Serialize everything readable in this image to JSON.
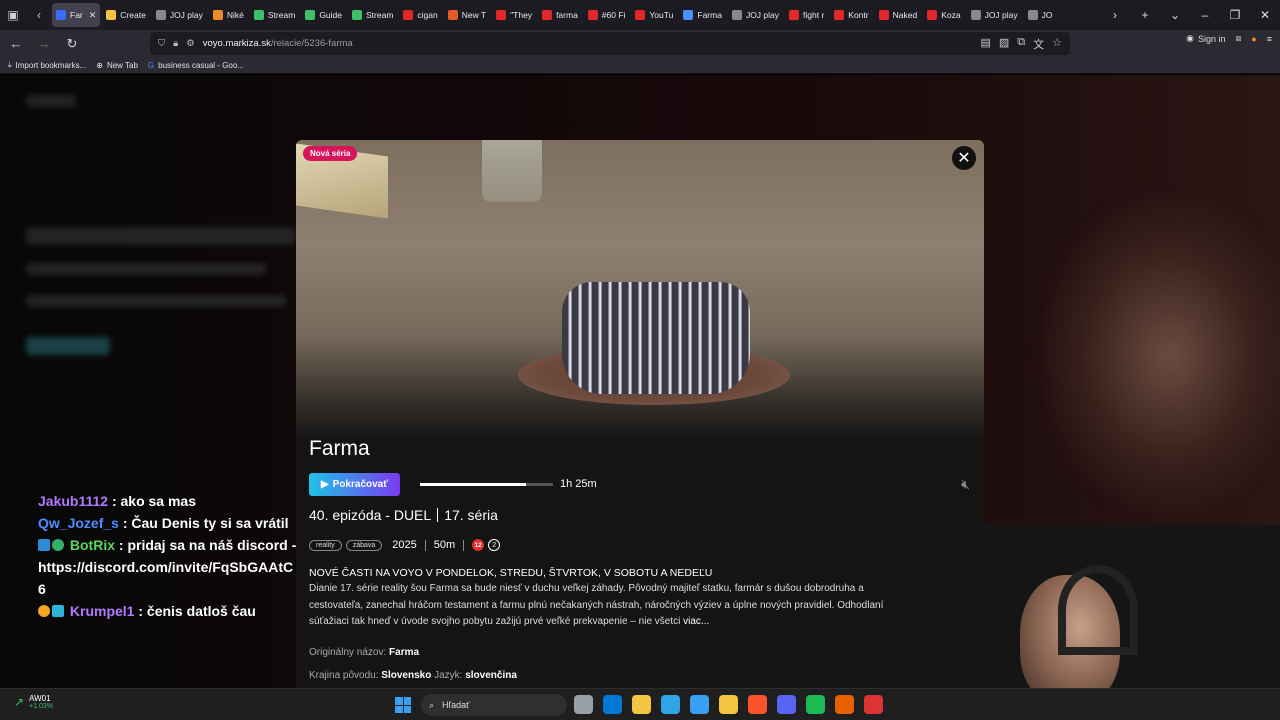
{
  "browser": {
    "tabs": [
      {
        "label": "Far",
        "color": "#3b6cff",
        "active": true
      },
      {
        "label": "Create",
        "color": "#f4c542"
      },
      {
        "label": "JOJ play",
        "color": "#888888"
      },
      {
        "label": "Niké",
        "color": "#f08a24"
      },
      {
        "label": "Stream",
        "color": "#3cc06a"
      },
      {
        "label": "Guide",
        "color": "#3cc06a"
      },
      {
        "label": "Stream",
        "color": "#3cc06a"
      },
      {
        "label": "cigan",
        "color": "#e3282c"
      },
      {
        "label": "New T",
        "color": "#e55b2b"
      },
      {
        "label": "\"They",
        "color": "#e3282c"
      },
      {
        "label": "farma",
        "color": "#e3282c"
      },
      {
        "label": "#60 Fi",
        "color": "#e3282c"
      },
      {
        "label": "YouTu",
        "color": "#e3282c"
      },
      {
        "label": "Farma",
        "color": "#4c8dff"
      },
      {
        "label": "JOJ play",
        "color": "#888888"
      },
      {
        "label": "fight r",
        "color": "#e3282c"
      },
      {
        "label": "Kontr",
        "color": "#e3282c"
      },
      {
        "label": "Naked",
        "color": "#e3282c"
      },
      {
        "label": "Koza",
        "color": "#e3282c"
      },
      {
        "label": "JOJ play",
        "color": "#888888"
      },
      {
        "label": "JO",
        "color": "#888888"
      }
    ],
    "url_domain": "voyo.markiza.sk",
    "url_path": "/relacie/5236-farma",
    "sign_in": "Sign in",
    "bookmarks": [
      "Import bookmarks...",
      "New Tab",
      "business casual - Goo..."
    ]
  },
  "chat": [
    {
      "user": "Jakub1112",
      "msg": ": ako sa mas"
    },
    {
      "user": "Qw_Jozef_s",
      "msg": ": Čau Denis ty si sa vrátil"
    },
    {
      "user": "BotRix",
      "msg": ": pridaj sa na náš discord - https://discord.com/invite/FqSbGAAtC6"
    },
    {
      "user": "Krumpel1",
      "msg": ": čenis datloš čau"
    }
  ],
  "modal": {
    "badge": "Nová séria",
    "title": "Farma",
    "play_label": "Pokračovať",
    "progress": 0.8,
    "duration": "1h 25m",
    "episode": "40. epizóda - DUEL",
    "season": "17. séria",
    "tags": [
      "reality",
      "zábava"
    ],
    "year": "2025",
    "length": "50m",
    "age_rating": "12",
    "age_rating_2": "2",
    "headline": "NOVÉ ČASTI NA VOYO V PONDELOK, STREDU, ŠTVRTOK, V SOBOTU A NEDEĽU",
    "description": "Dianie 17. série reality šou Farma sa bude niesť v duchu veľkej záhady. Pôvodný majiteľ statku, farmár s dušou dobrodruha a cestovateľa, zanechal hráčom testament a farmu plnú nečakaných nástrah, náročných výziev a úplne nových pravidiel. Odhodlaní súťažiaci tak hneď v úvode svojho pobytu zažijú prvé veľké prekvapenie – nie všetci",
    "more": "viac...",
    "original_title_label": "Originálny názov:",
    "original_title": "Farma",
    "country_label": "Krajina pôvodu:",
    "country": "Slovensko",
    "language_label": "Jazyk:",
    "language": "slovenčina"
  },
  "taskbar": {
    "stock_name": "AW01",
    "stock_change": "+1.03%",
    "search_placeholder": "Hľadať",
    "apps": [
      "#9aa0a8",
      "#0078d4",
      "#f4c542",
      "#2fa4e7",
      "#3aa0f3",
      "#f4c542",
      "#fb542b",
      "#5865f2",
      "#1db954",
      "#e66000",
      "#d33"
    ]
  }
}
